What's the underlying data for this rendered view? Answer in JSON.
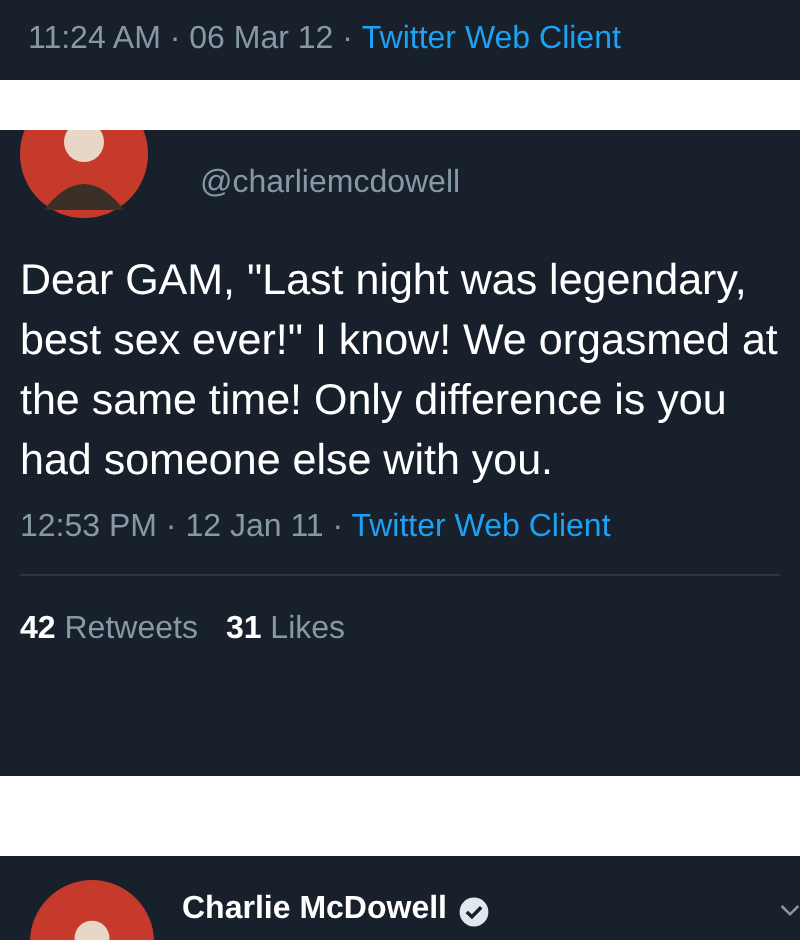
{
  "top_tweet": {
    "meta": "11:24 AM · 06 Mar 12 ·",
    "client": "Twitter Web Client"
  },
  "tweet": {
    "handle": "@charliemcdowell",
    "text": "Dear GAM, \"Last night was legendary, best sex ever!\" I know! We orgasmed at the same time! Only difference is you had someone else with you.",
    "meta": "12:53 PM · 12 Jan 11 ·",
    "client": "Twitter Web Client",
    "stats": [
      {
        "count": "42",
        "label": "Retweets"
      },
      {
        "count": "31",
        "label": "Likes"
      }
    ]
  },
  "next_tweet": {
    "name": "Charlie McDowell",
    "verified": true
  }
}
